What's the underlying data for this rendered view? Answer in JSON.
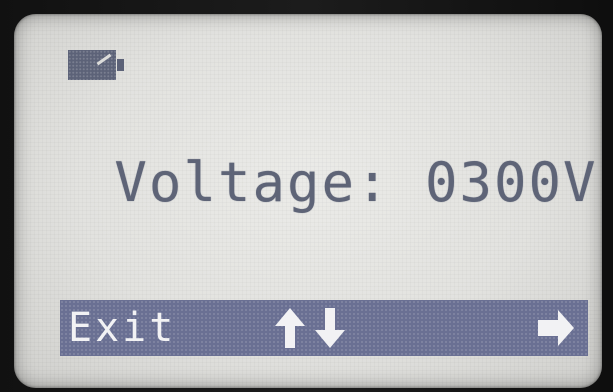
{
  "display": {
    "battery_icon": "battery-icon",
    "reading_text": "Voltage: 0300V",
    "colors": {
      "lcd_background": "#e5e5e2",
      "pixel_dark": "#5e6477",
      "softkey_bar": "#6a7093",
      "softkey_text": "#f2f2f4"
    }
  },
  "softkeys": {
    "exit_label": "Exit",
    "updown_icon": "up-down-arrows-icon",
    "enter_icon": "enter-arrow-icon"
  }
}
